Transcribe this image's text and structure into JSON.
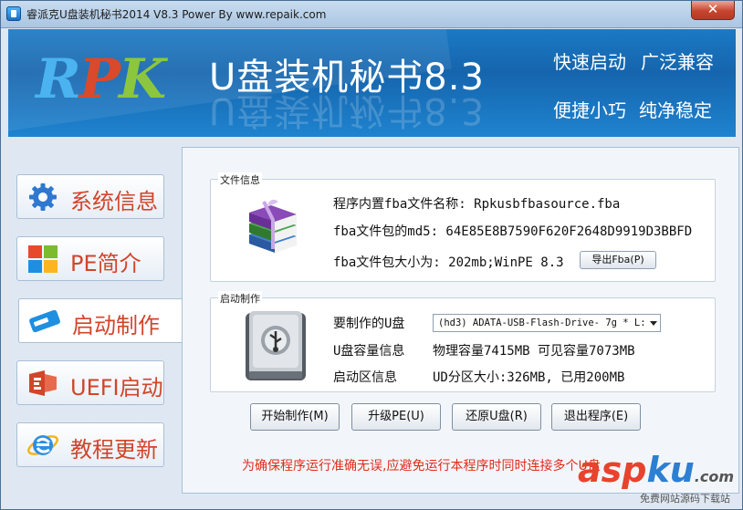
{
  "window": {
    "title": "睿派克U盘装机秘书2014 V8.3 Power By www.repaik.com",
    "close_label": "✕"
  },
  "header": {
    "logo": {
      "r": "R",
      "p": "P",
      "k": "K"
    },
    "title": "U盘装机秘书8.3",
    "features": [
      "快速启动",
      "广泛兼容",
      "便捷小巧",
      "纯净稳定"
    ]
  },
  "sidebar": {
    "items": [
      {
        "label": "系统信息",
        "icon": "gear-icon"
      },
      {
        "label": "PE简介",
        "icon": "windows-logo-icon"
      },
      {
        "label": "启动制作",
        "icon": "usb-drive-icon",
        "active": true
      },
      {
        "label": "UEFI启动",
        "icon": "uefi-icon"
      },
      {
        "label": "教程更新",
        "icon": "internet-explorer-icon"
      }
    ]
  },
  "file_info": {
    "group_title": "文件信息",
    "name_line": "程序内置fba文件名称:  Rpkusbfbasource.fba",
    "md5_line": "fba文件包的md5: 64E85E8B7590F620F2648D9919D3BBFD",
    "size_line": "fba文件包大小为: 202mb;WinPE 8.3",
    "export_button": "导出Fba(P)"
  },
  "boot_make": {
    "group_title": "启动制作",
    "target_label": "要制作的U盘",
    "target_value": "(hd3) ADATA-USB-Flash-Drive- 7g * L:",
    "capacity_label": "U盘容量信息",
    "capacity_value": "物理容量7415MB  可见容量7073MB",
    "boot_label": "启动区信息",
    "boot_value": "UD分区大小:326MB, 已用200MB"
  },
  "actions": {
    "start": "开始制作(M)",
    "upgrade": "升级PE(U)",
    "restore": "还原U盘(R)",
    "exit": "退出程序(E)"
  },
  "warning": "为确保程序运行准确无误,应避免运行本程序时同时连接多个U盘",
  "watermark": {
    "a": "asp",
    "k": "ku",
    "tld": ".com",
    "sub": "免费网站源码下载站"
  },
  "colors": {
    "accent_red": "#d1452a",
    "header_blue": "#1565ad",
    "warning_red": "#e22b1a"
  }
}
